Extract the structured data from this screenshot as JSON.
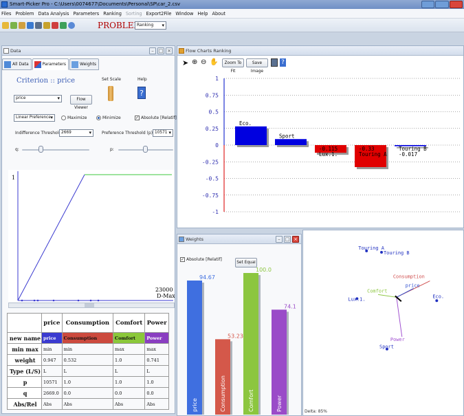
{
  "window": {
    "title": "Smart-Picker Pro - C:\\Users\\0074677\\Documents\\Personal\\SP\\car_2.csv"
  },
  "menu": [
    "Files",
    "Problem",
    "Data Analysis",
    "Parameters",
    "Ranking",
    "Sorting",
    "Export2File",
    "Window",
    "Help",
    "About"
  ],
  "toolbar": {
    "problem_label": "PROBLEM:",
    "problem_value": "Ranking"
  },
  "data_panel": {
    "title": "Data",
    "tabs": [
      "All Data",
      "Parameters",
      "Weights"
    ],
    "criterion_title": "Criterion :: price",
    "set_scale": "Set Scale",
    "help": "Help",
    "criterion_select": "price",
    "flow_viewer": "Flow Viewer",
    "pref_fn": "Linear Preference",
    "maximize": "Maximize",
    "minimize": "Minimize",
    "absolute": "Absolute [Relatif]",
    "indiff_label": "Indifference Threshold (q) :",
    "indiff_value": "2669",
    "pref_label": "Preference Threshold (p) :",
    "pref_value": "10571",
    "q_label": "q:",
    "p_label": "p:",
    "plot_y": "1",
    "plot_xmax": "23000",
    "plot_xlabel": "D-Max"
  },
  "table": {
    "headers": [
      "price",
      "Consumption",
      "Comfort",
      "Power"
    ],
    "rows": [
      {
        "label": "new name",
        "cells": [
          "price",
          "Consumption",
          "Comfort",
          "Power"
        ]
      },
      {
        "label": "min max",
        "cells": [
          "min",
          "min",
          "max",
          "max"
        ]
      },
      {
        "label": "weight",
        "cells": [
          "0.947",
          "0.532",
          "1.0",
          "0.741"
        ]
      },
      {
        "label": "Type (L/S)",
        "cells": [
          "L",
          "L",
          "L",
          "L"
        ]
      },
      {
        "label": "p",
        "cells": [
          "10571",
          "1.0",
          "1.0",
          "1.0"
        ]
      },
      {
        "label": "q",
        "cells": [
          "2669.0",
          "0.0",
          "0.0",
          "0.0"
        ]
      },
      {
        "label": "Abs/Rel",
        "cells": [
          "Abs",
          "Abs",
          "Abs",
          "Abs"
        ]
      }
    ],
    "colors": {
      "price": "#3a3ad0",
      "Consumption": "#cc4a3e",
      "Comfort": "#8bc83a",
      "Power": "#8a3ec1"
    }
  },
  "flow_panel": {
    "title": "Flow Charts Ranking",
    "zoom_btn": "Zoom To Fit",
    "save_btn": "Save Image"
  },
  "chart_data": [
    {
      "type": "bar",
      "title": "",
      "categories": [
        "Eco.",
        "Sport",
        "Lux.1.",
        "Touring A",
        "Touring B"
      ],
      "values": [
        0.28,
        0.09,
        -0.115,
        -0.33,
        -0.017
      ],
      "labels": [
        "Eco.",
        "Sport",
        "-0.115\nLux.1.",
        "-0.33\nTouring A",
        "Touring B\n-0.017"
      ],
      "colors": [
        "#0000e0",
        "#0000e0",
        "#e00000",
        "#e00000",
        "#0000e0"
      ],
      "yticks": [
        "1",
        "0.75",
        "0.5",
        "0.25",
        "0",
        "-0.25",
        "-0.5",
        "-0.75",
        "-1"
      ],
      "ylim": [
        -1,
        1
      ]
    },
    {
      "type": "bar",
      "title": "Weights",
      "categories": [
        "price",
        "Consumption",
        "Comfort",
        "Power"
      ],
      "values": [
        94.67,
        53.23,
        100.0,
        74.1
      ],
      "value_labels": [
        "94.67",
        "53.23",
        "100.0",
        "74.1"
      ],
      "colors": [
        "#3f6fe0",
        "#d4584a",
        "#8cc63f",
        "#9a4bc8"
      ],
      "ylim": [
        0,
        100
      ]
    }
  ],
  "weights_panel": {
    "title": "Weights",
    "absolute": "Absolute [Relatif]",
    "set_equal": "Set Equal"
  },
  "gaia": {
    "points": [
      "Touring A",
      "Touring B",
      "Eco.",
      "Lux.1.",
      "Sport"
    ],
    "vectors": [
      "Consumption",
      "price",
      "Comfort",
      "Power"
    ],
    "status": "Delta: 85%"
  }
}
